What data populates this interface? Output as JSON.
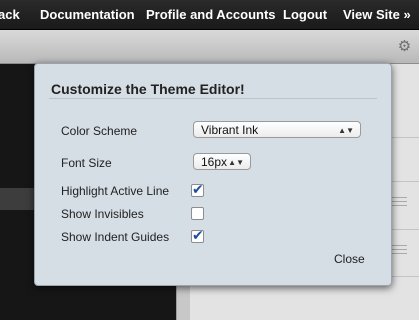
{
  "nav": {
    "items": [
      "ack",
      "Documentation",
      "Profile and Accounts",
      "Logout",
      "View Site »"
    ]
  },
  "toolbar": {
    "settings_icon": "gear-icon"
  },
  "dialog": {
    "title": "Customize the Theme Editor!",
    "color_scheme": {
      "label": "Color Scheme",
      "value": "Vibrant Ink"
    },
    "font_size": {
      "label": "Font Size",
      "value": "16px"
    },
    "highlight_active_line": {
      "label": "Highlight Active Line",
      "checked": true
    },
    "show_invisibles": {
      "label": "Show Invisibles",
      "checked": false
    },
    "show_indent_guides": {
      "label": "Show Indent Guides",
      "checked": true
    },
    "close_label": "Close"
  },
  "colors": {
    "nav_bg": "#1f1f1f",
    "dialog_bg": "#d5dde5",
    "checkbox_check": "#1f4f9c",
    "editor_bg": "#161616"
  }
}
